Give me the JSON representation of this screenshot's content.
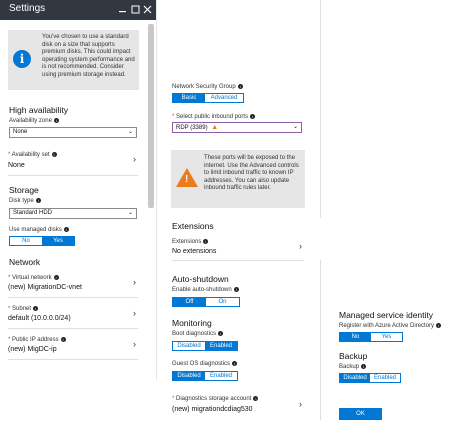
{
  "blade": {
    "title": "Settings"
  },
  "info_box": {
    "icon": "info-icon",
    "text": "You've chosen to use a standard disk on a size that supports premium disks. This could impact operating system performance and is not recommended. Consider using premium storage instead."
  },
  "high_availability": {
    "title": "High availability",
    "zone_label": "Availability zone",
    "zone_value": "None",
    "set_label": "Availability set",
    "set_value": "None"
  },
  "storage": {
    "title": "Storage",
    "disk_type_label": "Disk type",
    "disk_type_value": "Standard HDD",
    "managed_label": "Use managed disks",
    "managed_no": "No",
    "managed_yes": "Yes",
    "managed_selected": "Yes"
  },
  "network": {
    "title": "Network",
    "vnet_label": "Virtual network",
    "vnet_value": "(new) MigrationDC-vnet",
    "subnet_label": "Subnet",
    "subnet_value": "default (10.0.0.0/24)",
    "pip_label": "Public IP address",
    "pip_value": "(new) MigDC-ip"
  },
  "nsg": {
    "label": "Network Security Group",
    "basic": "Basic",
    "advanced": "Advanced",
    "selected": "Basic",
    "ports_label": "Select public inbound ports",
    "ports_value": "RDP (3389)",
    "warning_text": "These ports will be exposed to the internet. Use the Advanced controls to limit inbound traffic to known IP addresses. You can also update inbound traffic rules later."
  },
  "extensions": {
    "title": "Extensions",
    "label": "Extensions",
    "value": "No extensions"
  },
  "auto_shutdown": {
    "title": "Auto-shutdown",
    "label": "Enable auto-shutdown",
    "off": "Off",
    "on": "On",
    "selected": "Off"
  },
  "monitoring": {
    "title": "Monitoring",
    "boot_label": "Boot diagnostics",
    "guest_label": "Guest OS diagnostics",
    "disabled": "Disabled",
    "enabled": "Enabled",
    "boot_selected": "Enabled",
    "guest_selected": "Disabled",
    "storage_label": "Diagnostics storage account",
    "storage_value": "(new) migrationdcdiag530"
  },
  "msi": {
    "title": "Managed service identity",
    "label": "Register with Azure Active Directory",
    "no": "No",
    "yes": "Yes",
    "selected": "No"
  },
  "backup": {
    "title": "Backup",
    "label": "Backup",
    "disabled": "Disabled",
    "enabled": "Enabled",
    "selected": "Disabled"
  },
  "ok_label": "OK",
  "colors": {
    "accent": "#0078d4",
    "header_bg": "#32383f",
    "warning": "#ea7c1c",
    "required": "#d13438"
  }
}
